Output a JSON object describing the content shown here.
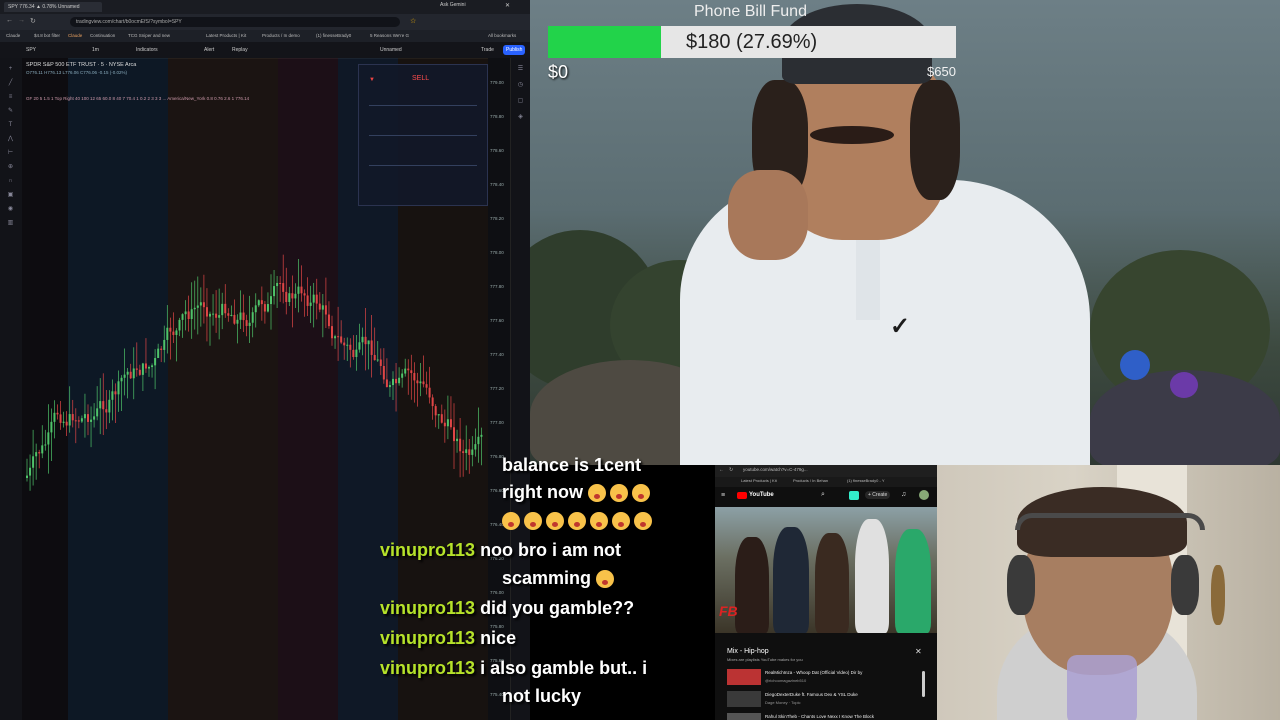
{
  "browser_left": {
    "tabs": [
      "SPY 776.34 ▲ 0.78% Unnamed",
      "Ask Gemini"
    ],
    "url": "tradingview.com/chart/b0ocmEfS/?symbol=SPY",
    "bookmarks": [
      "Claude",
      "$4.8 bot filter",
      "Claude",
      "Continuation",
      "TCG Sniper and new",
      "Latest Products | Kit",
      "Products / In demo",
      "(1) finesseBrady0",
      "5 Reasons We're G",
      "All bookmarks"
    ],
    "toolbar": [
      "SPY",
      "1m",
      "Indicators",
      "Alert",
      "Replay",
      "Unnamed",
      "Trade",
      "Publish"
    ],
    "symbol_title": "SPDR S&P 500 ETF TRUST · 5 · NYSE Arca",
    "ohlc": "O776.11 H776.13 L776.06 C776.06 -0.15 (-0.02%)",
    "indicator_text": "GF 20 5 1.5 1 Top Right 40 100 12 65 60.0 8 40 7 70.4 1 0.2 2 3 3 3 ... America/New_York 0.8 0.76 2.6 1 776.14",
    "order_panel_button": "SELL",
    "y_axis_labels": [
      "779.00",
      "778.80",
      "778.60",
      "778.40",
      "778.20",
      "778.00",
      "777.80",
      "777.60",
      "777.40",
      "777.20",
      "777.00",
      "776.80",
      "776.60",
      "776.40",
      "776.20",
      "776.00",
      "775.80",
      "775.60",
      "775.40"
    ]
  },
  "overlay": {
    "fund_title": "Phone Bill Fund",
    "fund_progress": "$180 (27.69%)",
    "fund_start": "$0",
    "fund_goal": "$650",
    "progress_fraction": 0.2769,
    "bar_color": "#22d34a"
  },
  "chat": [
    {
      "user": "",
      "message": "balance is 1cent"
    },
    {
      "user": "",
      "message": "right now",
      "emotes": 3
    },
    {
      "user": "",
      "message": "",
      "emotes": 7
    },
    {
      "user": "vinupro113",
      "message": "noo bro i am not"
    },
    {
      "user": "",
      "message": "scamming",
      "emotes": 1
    },
    {
      "user": "vinupro113",
      "message": "did you gamble??"
    },
    {
      "user": "vinupro113",
      "message": "nice"
    },
    {
      "user": "vinupro113",
      "message": "i also gamble but.. i"
    },
    {
      "user": "",
      "message": "not lucky"
    }
  ],
  "youtube": {
    "url": "youtube.com/watch?v=C-479g...",
    "bookmarks": [
      "Latest Products | Kit",
      "Products / In Behan",
      "(1) finesseBrady0 - Y"
    ],
    "logo": "YouTube",
    "create_label": "+ Create",
    "playlist_title": "Mix - Hip-hop",
    "playlist_sub": "Mixes are playlists YouTube makes for you",
    "items": [
      {
        "title": "RealMichInza - Whoop Dat (Official Video) Dir by",
        "sub": "@richoomagazineb510"
      },
      {
        "title": "DiegoDexterDuke ft. Famous Dex & YSL Duke",
        "sub": "Dage Money · Topic"
      },
      {
        "title": "Rahul SkinTheb - Chants Love Nexx I Know The Block",
        "sub": ""
      }
    ],
    "close_icon": "✕"
  }
}
